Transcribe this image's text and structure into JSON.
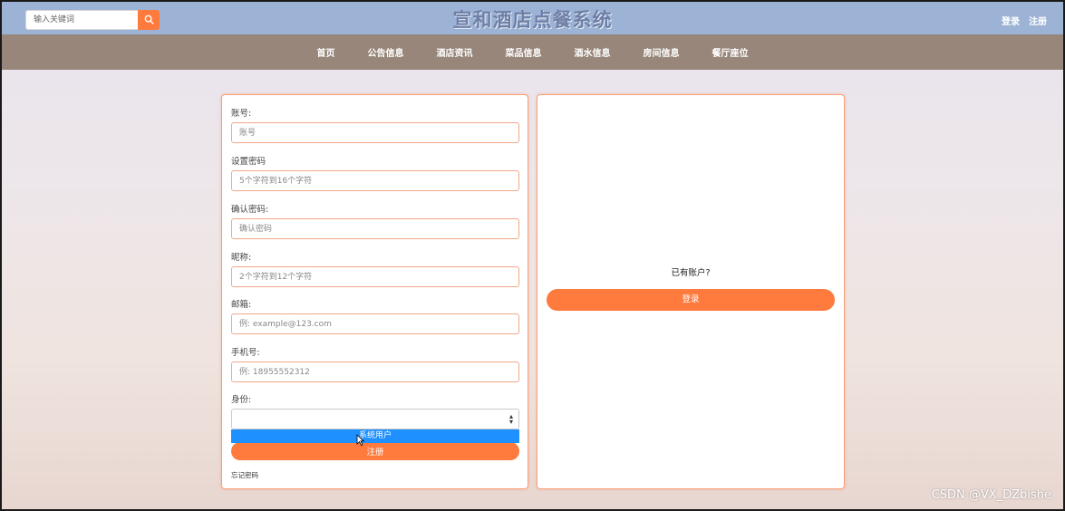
{
  "header": {
    "search_placeholder": "输入关键词",
    "site_title": "宣和酒店点餐系统",
    "login_link": "登录",
    "register_link": "注册"
  },
  "nav": {
    "items": [
      "首页",
      "公告信息",
      "酒店资讯",
      "菜品信息",
      "酒水信息",
      "房间信息",
      "餐厅座位"
    ]
  },
  "register_form": {
    "account_label": "账号:",
    "account_placeholder": "账号",
    "password_label": "设置密码",
    "password_placeholder": "5个字符到16个字符",
    "confirm_label": "确认密码:",
    "confirm_placeholder": "确认密码",
    "nickname_label": "昵称:",
    "nickname_placeholder": "2个字符到12个字符",
    "email_label": "邮箱:",
    "email_placeholder": "例: example@123.com",
    "phone_label": "手机号:",
    "phone_placeholder": "例: 18955552312",
    "identity_label": "身份:",
    "identity_selected": "",
    "identity_options": [
      "系统用户"
    ],
    "register_button": "注册",
    "forgot_password": "忘记密码"
  },
  "login_panel": {
    "have_account_text": "已有账户?",
    "login_button": "登录"
  },
  "watermark": "CSDN @VX_DZbishe",
  "colors": {
    "topbar": "#9db3d6",
    "navbar": "#978679",
    "accent": "#ff7a3d",
    "dropdown_highlight": "#1e90ff"
  }
}
